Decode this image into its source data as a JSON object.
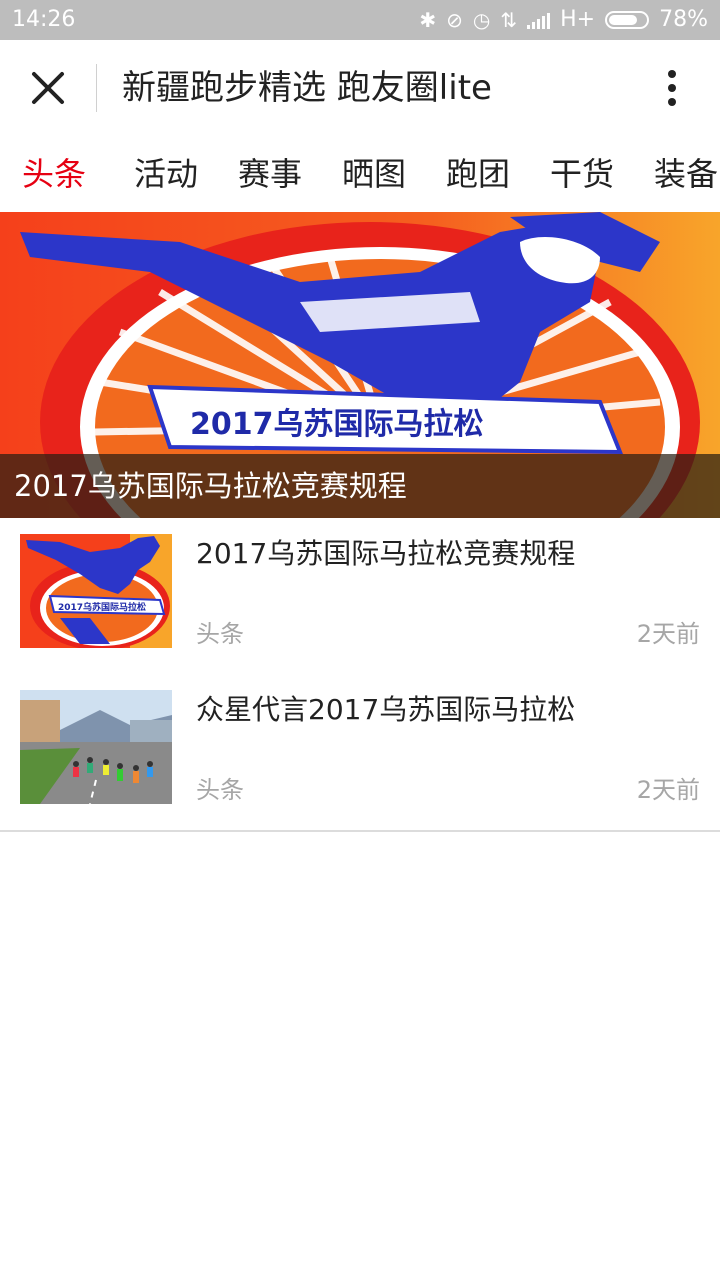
{
  "status_bar": {
    "time": "14:26",
    "network": "H+",
    "battery": "78%",
    "battery_level": 0.78,
    "icons": [
      "bluetooth-icon",
      "alarm-off-icon",
      "alarm-clock-icon",
      "data-arrows-icon",
      "signal-icon",
      "battery-icon"
    ]
  },
  "header": {
    "title": "新疆跑步精选 跑友圈lite",
    "close_icon": "close-icon",
    "more_icon": "more-vertical-icon"
  },
  "tabs": [
    {
      "label": "头条",
      "active": true
    },
    {
      "label": "活动",
      "active": false
    },
    {
      "label": "赛事",
      "active": false
    },
    {
      "label": "晒图",
      "active": false
    },
    {
      "label": "跑团",
      "active": false
    },
    {
      "label": "干货",
      "active": false
    },
    {
      "label": "装备",
      "active": false
    }
  ],
  "hero": {
    "caption": "2017乌苏国际马拉松竞赛规程",
    "banner_text": "2017乌苏国际马拉松"
  },
  "news": [
    {
      "title": "2017乌苏国际马拉松竞赛规程",
      "category": "头条",
      "time": "2天前",
      "thumb_text": "2017乌苏国际马拉松"
    },
    {
      "title": "众星代言2017乌苏国际马拉松",
      "category": "头条",
      "time": "2天前"
    }
  ],
  "colors": {
    "accent": "#e60012",
    "status_bar": "#bdbdbd",
    "meta_text": "#a6a6a6"
  }
}
